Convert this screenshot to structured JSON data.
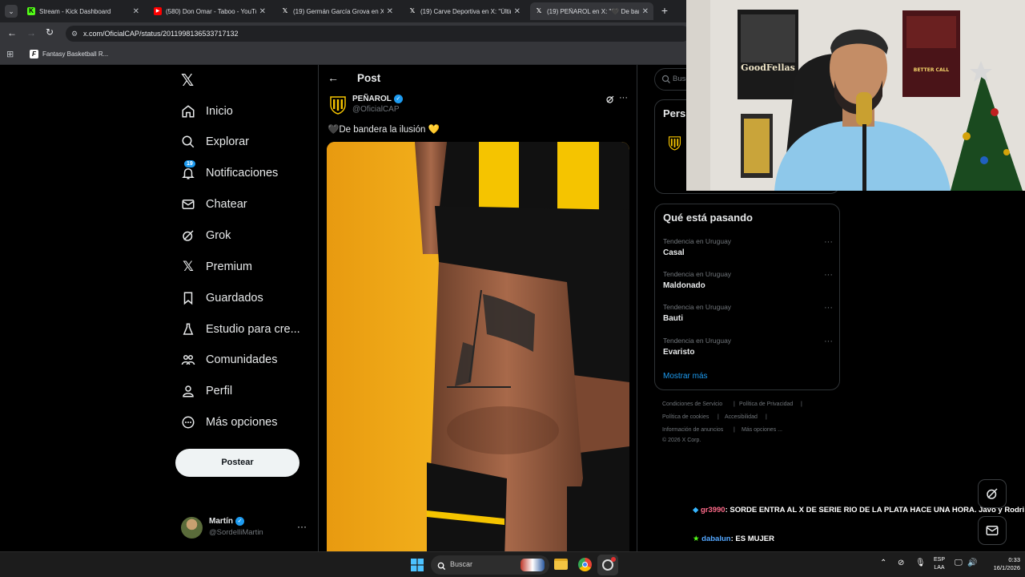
{
  "browser": {
    "tabs": [
      {
        "title": "Stream - Kick Dashboard",
        "icon": "kick-icon"
      },
      {
        "title": "(580) Don Omar - Taboo - YouTube",
        "icon": "youtube-icon"
      },
      {
        "title": "(19) Germán García Grova en X",
        "icon": "x-icon"
      },
      {
        "title": "(19) Carve Deportiva en X: \"Último",
        "icon": "x-icon"
      },
      {
        "title": "(19) PEÑAROL en X: \"🖤 De bandera",
        "icon": "x-icon"
      }
    ],
    "url": "x.com/OficialCAP/status/2011998136533717132",
    "bookmark": "Fantasy Basketball R..."
  },
  "nav": {
    "items": [
      {
        "label": "Inicio",
        "icon": "home-icon"
      },
      {
        "label": "Explorar",
        "icon": "search-icon"
      },
      {
        "label": "Notificaciones",
        "icon": "bell-icon",
        "badge": "19"
      },
      {
        "label": "Chatear",
        "icon": "mail-icon"
      },
      {
        "label": "Grok",
        "icon": "grok-icon"
      },
      {
        "label": "Premium",
        "icon": "x-logo-icon"
      },
      {
        "label": "Guardados",
        "icon": "bookmark-icon"
      },
      {
        "label": "Estudio para cre...",
        "icon": "studio-icon"
      },
      {
        "label": "Comunidades",
        "icon": "communities-icon"
      },
      {
        "label": "Perfil",
        "icon": "person-icon"
      },
      {
        "label": "Más opciones",
        "icon": "more-circle-icon"
      }
    ],
    "post_button": "Postear",
    "account": {
      "name": "Martín",
      "handle": "@SordelliMartin"
    }
  },
  "post": {
    "header_title": "Post",
    "author_name": "PEÑAROL",
    "author_handle": "@OficialCAP",
    "text": "🖤De bandera la ilusión 💛"
  },
  "sidebar": {
    "search_placeholder": "Buscar",
    "persons_title": "Pers",
    "trends_title": "Qué está pasando",
    "trends": [
      {
        "context": "Tendencia en Uruguay",
        "name": "Casal"
      },
      {
        "context": "Tendencia en Uruguay",
        "name": "Maldonado"
      },
      {
        "context": "Tendencia en Uruguay",
        "name": "Bauti"
      },
      {
        "context": "Tendencia en Uruguay",
        "name": "Evaristo"
      }
    ],
    "show_more": "Mostrar más",
    "footer": [
      "Condiciones de Servicio",
      "Política de Privacidad",
      "Política de cookies",
      "Accesibilidad",
      "Información de anuncios",
      "Más opciones ...",
      "© 2026 X Corp."
    ]
  },
  "chat": {
    "messages": [
      {
        "user": "gr3990",
        "text": ": SORDE ENTRA AL X DE SERIE RIO DE LA PLATA HACE UNA HORA. Javo y Rodri",
        "user_color": "#ff6b8a"
      },
      {
        "user": "dabalun",
        "text": ": ES MUJER",
        "user_color": "#53a7ff"
      }
    ]
  },
  "webcam": {
    "posters": [
      "GoodFellas",
      "BETTER CALL"
    ]
  },
  "taskbar": {
    "search": "Buscar",
    "lang_top": "ESP",
    "lang_bottom": "LAA",
    "time": "0:33",
    "date": "16/1/2026"
  },
  "colors": {
    "accent": "#1d9bf0",
    "penarol_yellow": "#f5c400",
    "bg": "#000000",
    "border": "#2f3336"
  }
}
